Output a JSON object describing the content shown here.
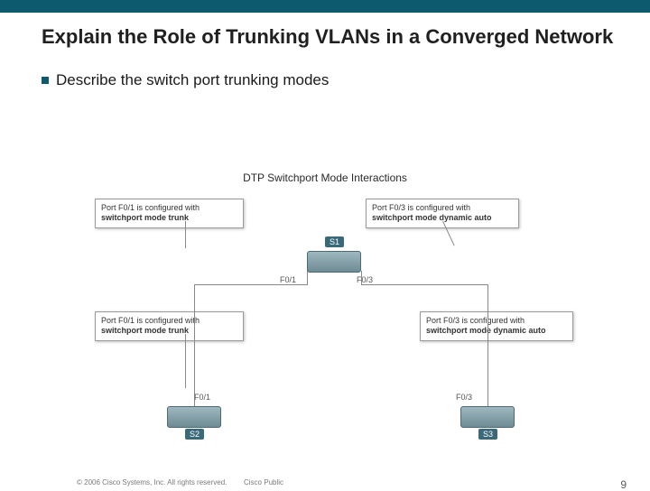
{
  "title": "Explain the Role of Trunking VLANs in a Converged Network",
  "bullet": "Describe the switch port trunking modes",
  "diagram": {
    "title": "DTP Switchport Mode Interactions",
    "switches": {
      "s1": "S1",
      "s2": "S2",
      "s3": "S3"
    },
    "ports": {
      "s1_left": "F0/1",
      "s1_right": "F0/3",
      "s2": "F0/1",
      "s3": "F0/3"
    },
    "boxes": {
      "tl": {
        "line1": "Port F0/1 is configured with",
        "line2": "switchport mode trunk"
      },
      "tr": {
        "line1": "Port F0/3 is configured with",
        "line2": "switchport mode dynamic auto"
      },
      "bl": {
        "line1": "Port F0/1 is configured with",
        "line2": "switchport mode trunk"
      },
      "br": {
        "line1": "Port F0/3 is configured with",
        "line2": "switchport mode dynamic auto"
      }
    }
  },
  "footer": {
    "copyright": "© 2006 Cisco Systems, Inc. All rights reserved.",
    "public": "Cisco Public",
    "page": "9"
  }
}
